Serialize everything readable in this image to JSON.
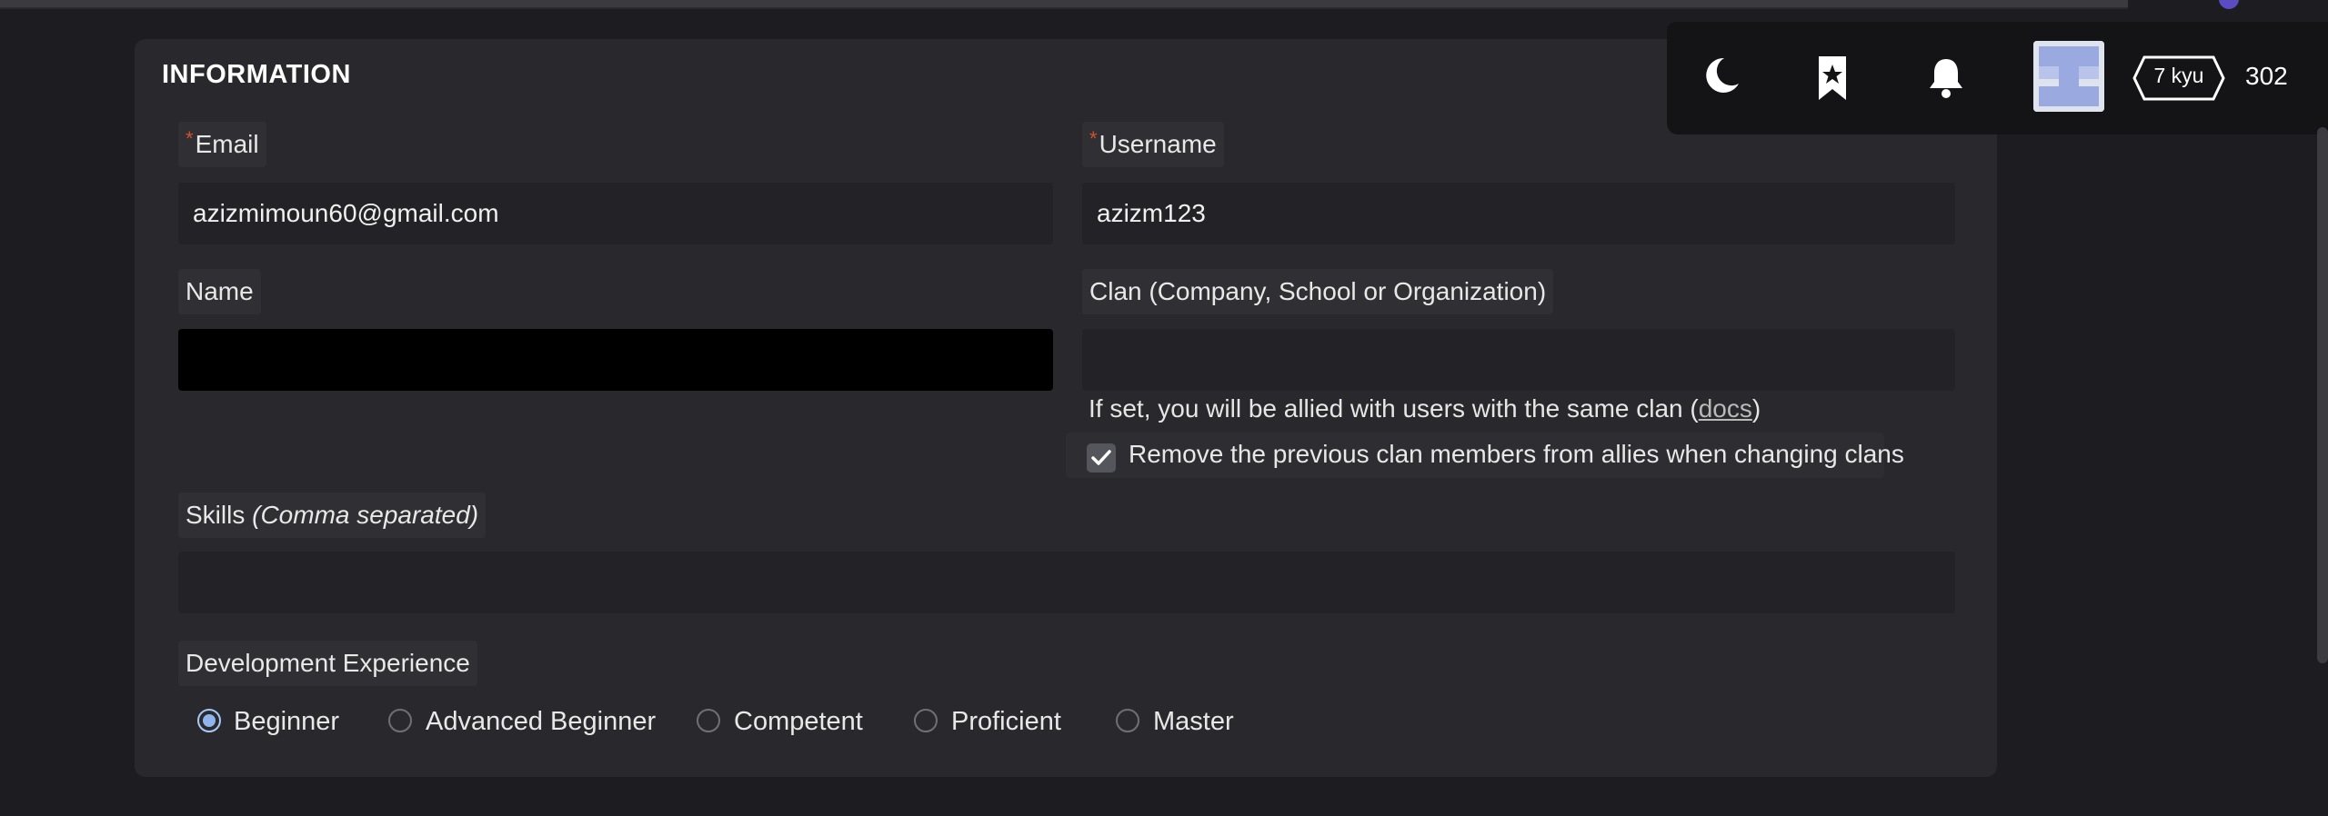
{
  "section": {
    "title": "INFORMATION"
  },
  "fields": {
    "email": {
      "label": "Email",
      "required_mark": "*",
      "value": "azizmimoun60@gmail.com"
    },
    "username": {
      "label": "Username",
      "required_mark": "*",
      "value": "azizm123"
    },
    "name": {
      "label": "Name",
      "value": ""
    },
    "clan": {
      "label": "Clan (Company, School or Organization)",
      "value": "",
      "hint_prefix": "If set, you will be allied with users with the same clan (",
      "hint_link": "docs",
      "hint_suffix": ")",
      "checkbox_label": "Remove the previous clan members from allies when changing clans",
      "checkbox_checked": true
    },
    "skills": {
      "label": "Skills",
      "label_note": "(Comma separated)",
      "value": ""
    },
    "experience": {
      "label": "Development Experience",
      "options": [
        "Beginner",
        "Advanced Beginner",
        "Competent",
        "Proficient",
        "Master"
      ],
      "selected": "Beginner"
    }
  },
  "navbar": {
    "icons": [
      "moon-icon",
      "bookmark-star-icon",
      "bell-icon"
    ],
    "rank": "7 kyu",
    "honor": "302"
  },
  "colors": {
    "background": "#1d1d21",
    "card": "#29292d",
    "required": "#d2512e",
    "radio_selected": "#8fb4ec"
  }
}
